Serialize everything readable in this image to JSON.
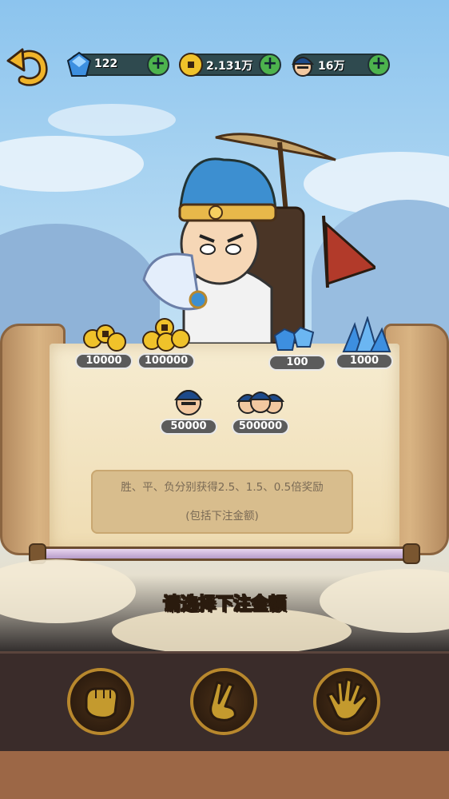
{
  "resources": [
    {
      "icon": "gem-icon",
      "value": "122"
    },
    {
      "icon": "coin-icon",
      "value": "2.131万"
    },
    {
      "icon": "soldier-icon",
      "value": "16万"
    }
  ],
  "bets": {
    "coins_small": "10000",
    "coins_large": "100000",
    "gems_small": "100",
    "gems_large": "1000",
    "soldiers_one": "50000",
    "soldiers_three": "500000"
  },
  "info": {
    "line1": "胜、平、负分别获得2.5、1.5、0.5倍奖励",
    "line2": "(包括下注金额)"
  },
  "prompt": "请选择下注金额",
  "colors": {
    "accent_gold": "#b8882d",
    "pill_bg": "#5b5b5b",
    "plus_green": "#4db34d"
  }
}
